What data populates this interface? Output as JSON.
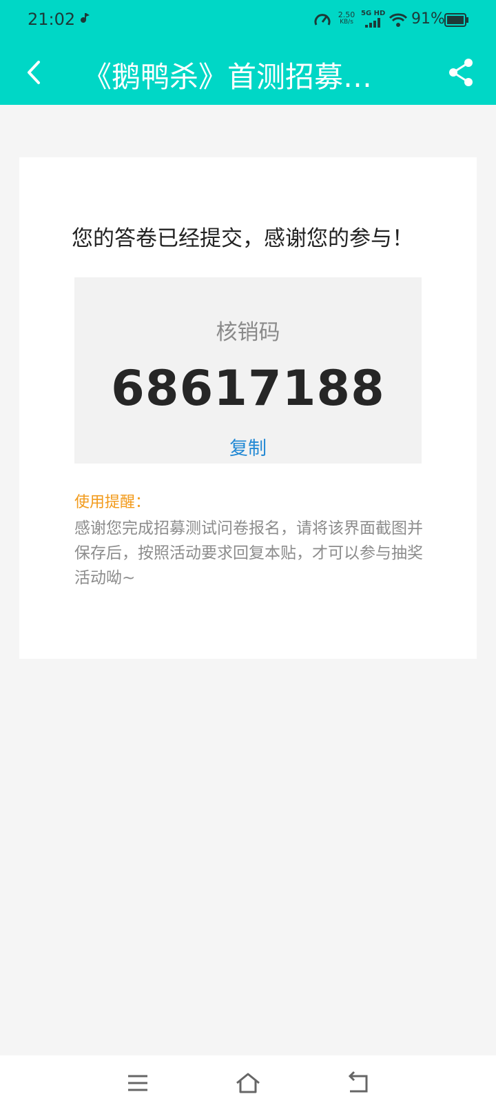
{
  "status_bar": {
    "time": "21:02",
    "net_speed": "2.50",
    "net_speed_unit": "KB/s",
    "network_type": "5G HD",
    "battery": "91%"
  },
  "header": {
    "title": "《鹅鸭杀》首测招募…"
  },
  "card": {
    "thanks_message": "您的答卷已经提交，感谢您的参与！",
    "code_label": "核销码",
    "code_value": "68617188",
    "copy_label": "复制",
    "tip_title": "使用提醒：",
    "tip_text": "感谢您完成招募测试问卷报名，请将该界面截图并保存后，按照活动要求回复本贴，才可以参与抽奖活动呦~"
  },
  "icons": {
    "back": "chevron-left-icon",
    "share": "share-icon",
    "menu": "menu-icon",
    "home": "home-icon",
    "return": "return-icon"
  },
  "colors": {
    "header_bg": "#00d7c6",
    "copy_link": "#2389d4",
    "tip_title": "#f29a1a"
  }
}
